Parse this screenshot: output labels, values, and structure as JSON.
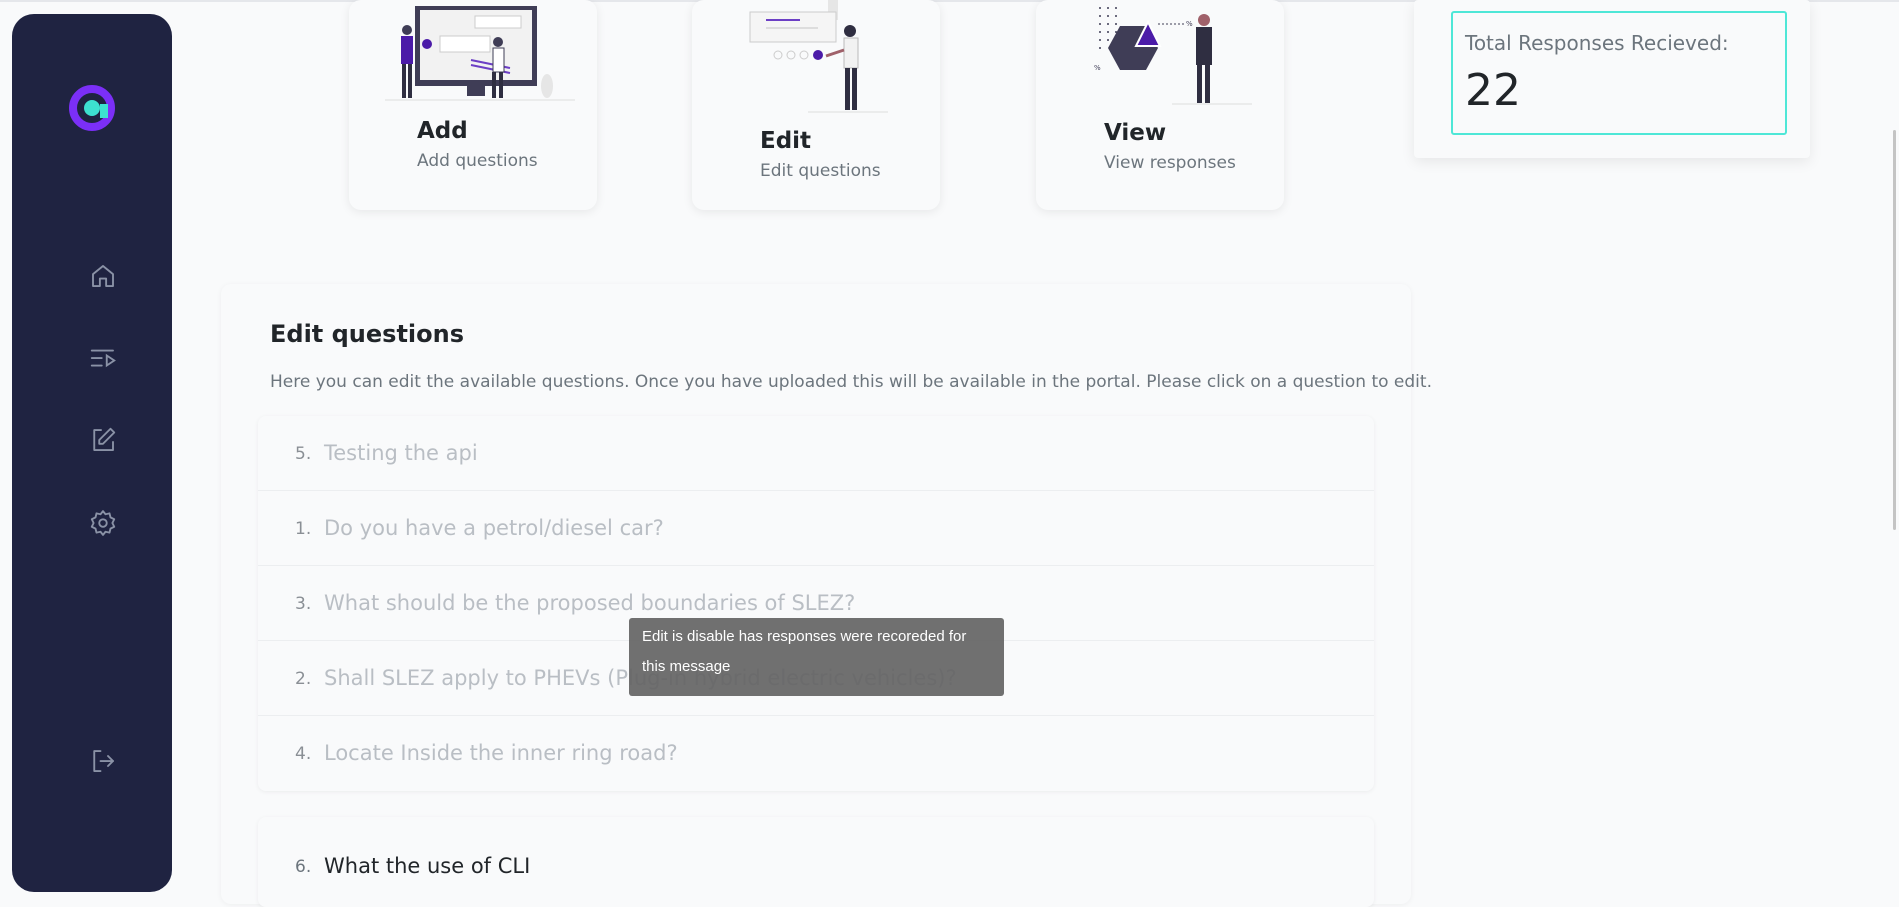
{
  "sidebar": {
    "icons": [
      "logo-icon",
      "home-icon",
      "playlist-icon",
      "edit-icon",
      "settings-icon",
      "logout-icon"
    ],
    "accent_color": "#7b2ff7",
    "logo_color": "#3de0d0"
  },
  "cards": [
    {
      "title": "Add",
      "subtitle": "Add questions"
    },
    {
      "title": "Edit",
      "subtitle": "Edit questions"
    },
    {
      "title": "View",
      "subtitle": "View responses"
    }
  ],
  "responses": {
    "label": "Total Responses Recieved:",
    "value": "22"
  },
  "section": {
    "title": "Edit questions",
    "description": "Here you can edit the available questions. Once you have uploaded this will be available in the portal. Please click on a question to edit."
  },
  "questions_disabled": [
    {
      "num": "5.",
      "text": "Testing the api"
    },
    {
      "num": "1.",
      "text": "Do you have a petrol/diesel car?"
    },
    {
      "num": "3.",
      "text": "What should be the proposed boundaries of SLEZ?"
    },
    {
      "num": "2.",
      "text": "Shall SLEZ apply to PHEVs (Plug-in hybrid electric vehicles)?"
    },
    {
      "num": "4.",
      "text": "Locate Inside the inner ring road?"
    }
  ],
  "question_active": {
    "num": "6.",
    "text": "What the use of CLI"
  },
  "tooltip": {
    "text": "Edit is disable has responses were recoreded for this message"
  }
}
